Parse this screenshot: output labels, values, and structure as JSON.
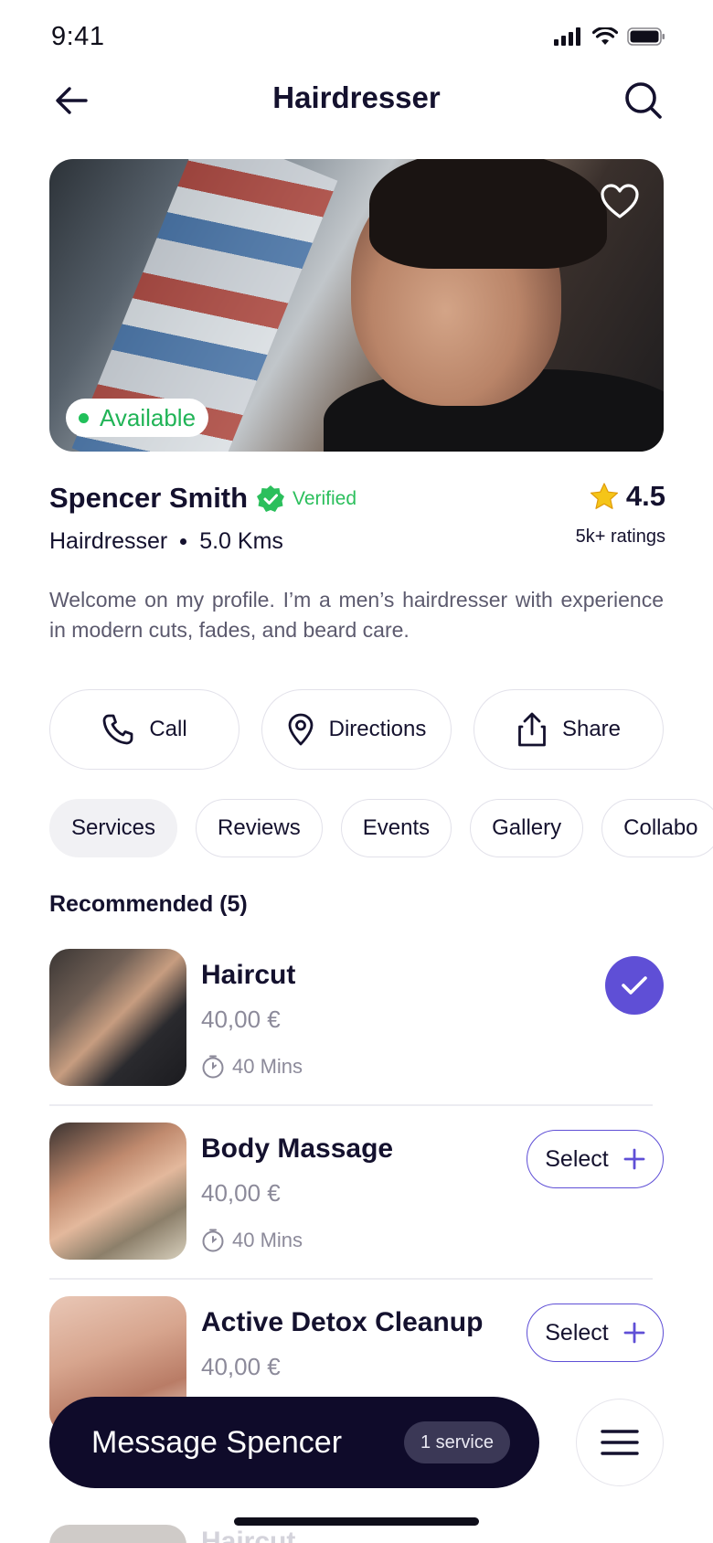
{
  "status_bar": {
    "time": "9:41"
  },
  "header": {
    "title": "Hairdresser"
  },
  "hero": {
    "availability": "Available"
  },
  "profile": {
    "name": "Spencer Smith",
    "verified_label": "Verified",
    "rating": "4.5",
    "ratings_count": "5k+ ratings",
    "profession": "Hairdresser",
    "distance": "5.0 Kms",
    "bio": "Welcome on my profile. I’m a men’s hairdresser with experience in modern cuts, fades, and beard care."
  },
  "actions": {
    "call": "Call",
    "directions": "Directions",
    "share": "Share"
  },
  "tabs": [
    {
      "label": "Services"
    },
    {
      "label": "Reviews"
    },
    {
      "label": "Events"
    },
    {
      "label": "Gallery"
    },
    {
      "label": "Collabo"
    }
  ],
  "recommended": {
    "title": "Recommended (5)",
    "services": [
      {
        "name": "Haircut",
        "price": "40,00 €",
        "duration": "40 Mins",
        "selected": true
      },
      {
        "name": "Body Massage",
        "price": "40,00 €",
        "duration": "40 Mins",
        "selected": false,
        "select_label": "Select"
      },
      {
        "name": "Active Detox Cleanup",
        "price": "40,00 €",
        "selected": false,
        "select_label": "Select"
      }
    ]
  },
  "background_peek": {
    "service_name": "Haircut"
  },
  "cta": {
    "label": "Message Spencer",
    "badge": "1 service"
  },
  "colors": {
    "accent": "#5f4fd6",
    "dark": "#0f0b2a",
    "success": "#21b457",
    "star": "#f5b80f"
  },
  "icons": [
    "back-arrow-icon",
    "search-icon",
    "heart-icon",
    "verified-badge-icon",
    "star-icon",
    "phone-icon",
    "location-pin-icon",
    "share-icon",
    "clock-icon",
    "check-icon",
    "plus-icon",
    "menu-icon"
  ]
}
